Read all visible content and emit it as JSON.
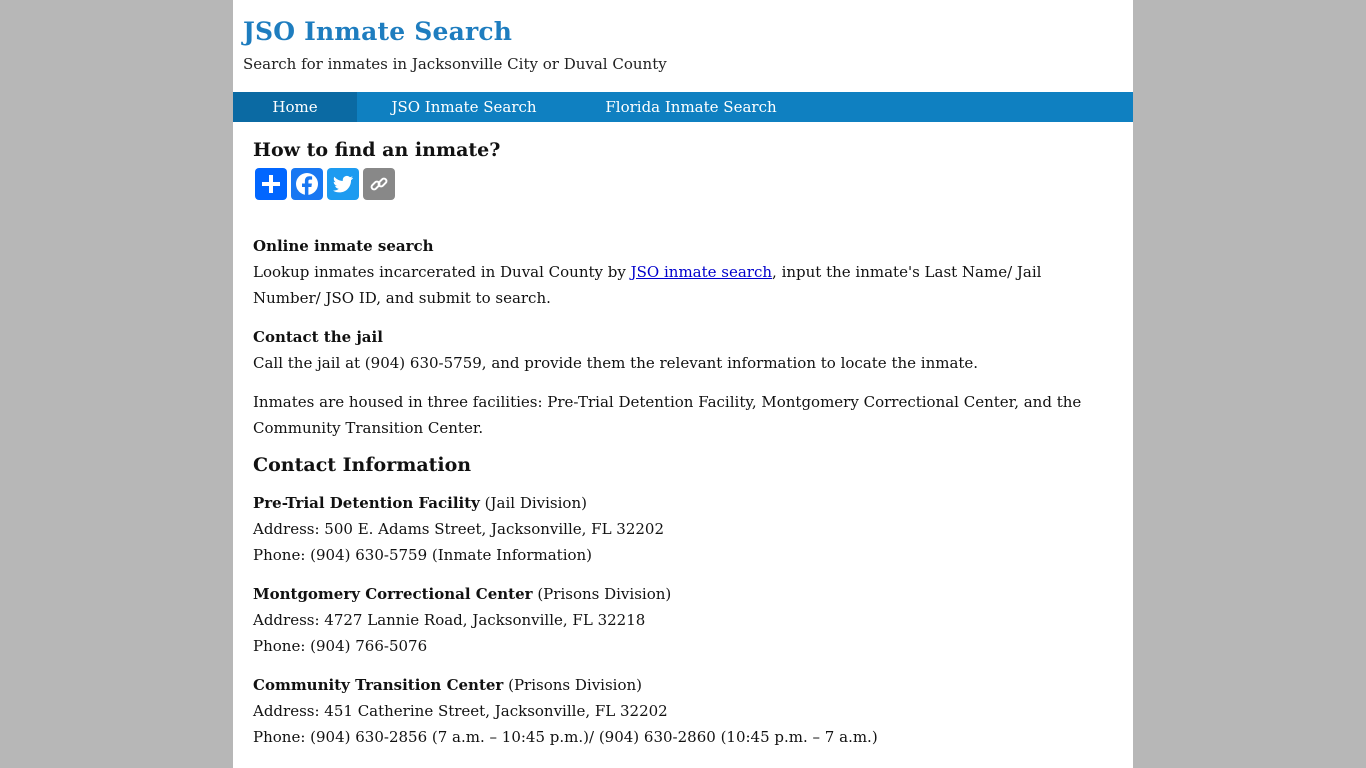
{
  "header": {
    "title": "JSO Inmate Search",
    "tagline": "Search for inmates in Jacksonville City or Duval County"
  },
  "nav": {
    "items": [
      {
        "label": "Home",
        "active": true
      },
      {
        "label": "JSO Inmate Search",
        "active": false
      },
      {
        "label": "Florida Inmate Search",
        "active": false
      }
    ]
  },
  "content": {
    "heading": "How to find an inmate?",
    "share_icons": [
      "share-plus-icon",
      "facebook-icon",
      "twitter-icon",
      "copy-link-icon"
    ],
    "online": {
      "heading": "Online inmate search",
      "text_before": "Lookup inmates incarcerated in Duval County by ",
      "link": "JSO inmate search",
      "text_after": ", input the inmate's Last Name/ Jail Number/ JSO ID, and submit to search."
    },
    "contact_jail": {
      "heading": "Contact the jail",
      "text": "Call the jail at (904) 630-5759, and provide them the relevant information to locate the inmate."
    },
    "facilities_text": "Inmates are housed in three facilities: Pre-Trial Detention Facility, Montgomery Correctional Center, and the Community Transition Center.",
    "contact_info_heading": "Contact Information",
    "facilities": [
      {
        "name": "Pre-Trial Detention Facility",
        "division": " (Jail Division)",
        "address": "Address: 500 E. Adams Street, Jacksonville, FL 32202",
        "phone": "Phone: (904) 630-5759 (Inmate Information)"
      },
      {
        "name": "Montgomery Correctional Center",
        "division": " (Prisons Division)",
        "address": "Address: 4727 Lannie Road, Jacksonville, FL 32218",
        "phone": "Phone: (904) 766-5076"
      },
      {
        "name": "Community Transition Center",
        "division": " (Prisons Division)",
        "address": "Address: 451 Catherine Street, Jacksonville, FL 32202",
        "phone": "Phone: (904) 630-2856 (7 a.m. – 10:45 p.m.)/ (904) 630-2860 (10:45 p.m. – 7 a.m.)"
      }
    ]
  }
}
